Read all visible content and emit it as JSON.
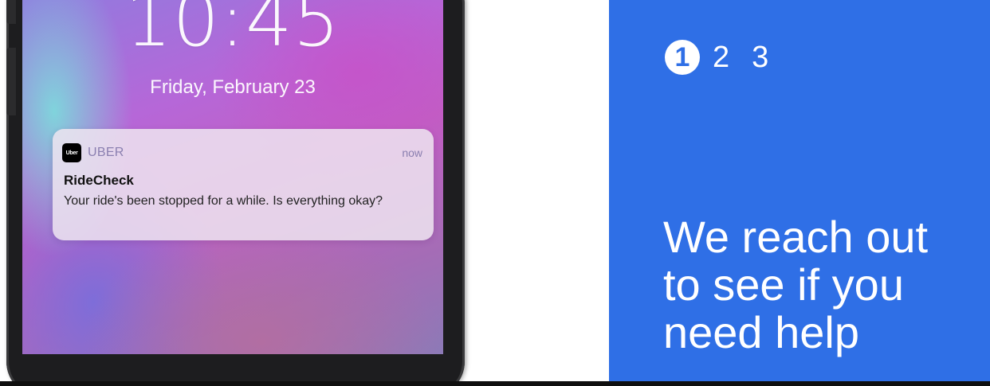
{
  "lock_screen": {
    "time": "10:45",
    "date": "Friday, February 23"
  },
  "notification": {
    "app_icon_text": "Uber",
    "app_name": "UBER",
    "timestamp": "now",
    "title": "RideCheck",
    "body": "Your ride's been stopped for a while. Is everything okay?"
  },
  "steps": {
    "items": [
      "1",
      "2",
      "3"
    ],
    "active_index": 0
  },
  "headline": {
    "lines": [
      "We reach out",
      "to see if you",
      "need help"
    ]
  },
  "colors": {
    "panel_blue": "#2f6fe6",
    "phone_frame": "#1d1d1f",
    "notification_bg": "#eee4f0"
  }
}
